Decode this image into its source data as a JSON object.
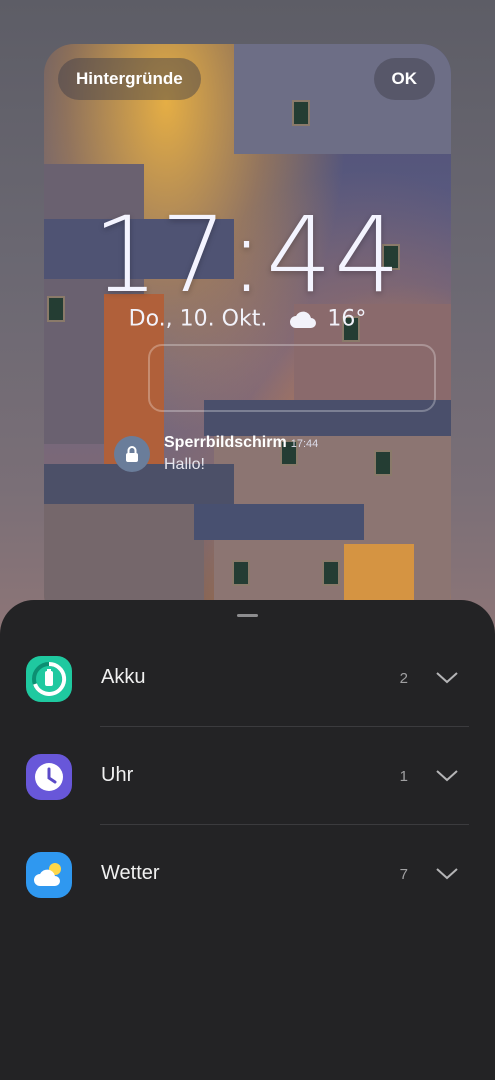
{
  "preview": {
    "wallpapers_button": "Hintergründe",
    "ok_button": "OK",
    "clock_time": "17:44",
    "date": "Do., 10. Okt.",
    "weather_icon": "cloud-icon",
    "temperature": "16°",
    "notification": {
      "icon": "lock-icon",
      "title": "Sperrbildschirm",
      "time": "17:44",
      "body": "Hallo!"
    }
  },
  "sheet": {
    "rows": [
      {
        "label": "Akku",
        "count": "2",
        "icon": "battery-icon",
        "color": "#1fc9a0"
      },
      {
        "label": "Uhr",
        "count": "1",
        "icon": "clock-icon",
        "color": "#6857d9"
      },
      {
        "label": "Wetter",
        "count": "7",
        "icon": "weather-icon",
        "color": "#2f98f0"
      }
    ]
  }
}
